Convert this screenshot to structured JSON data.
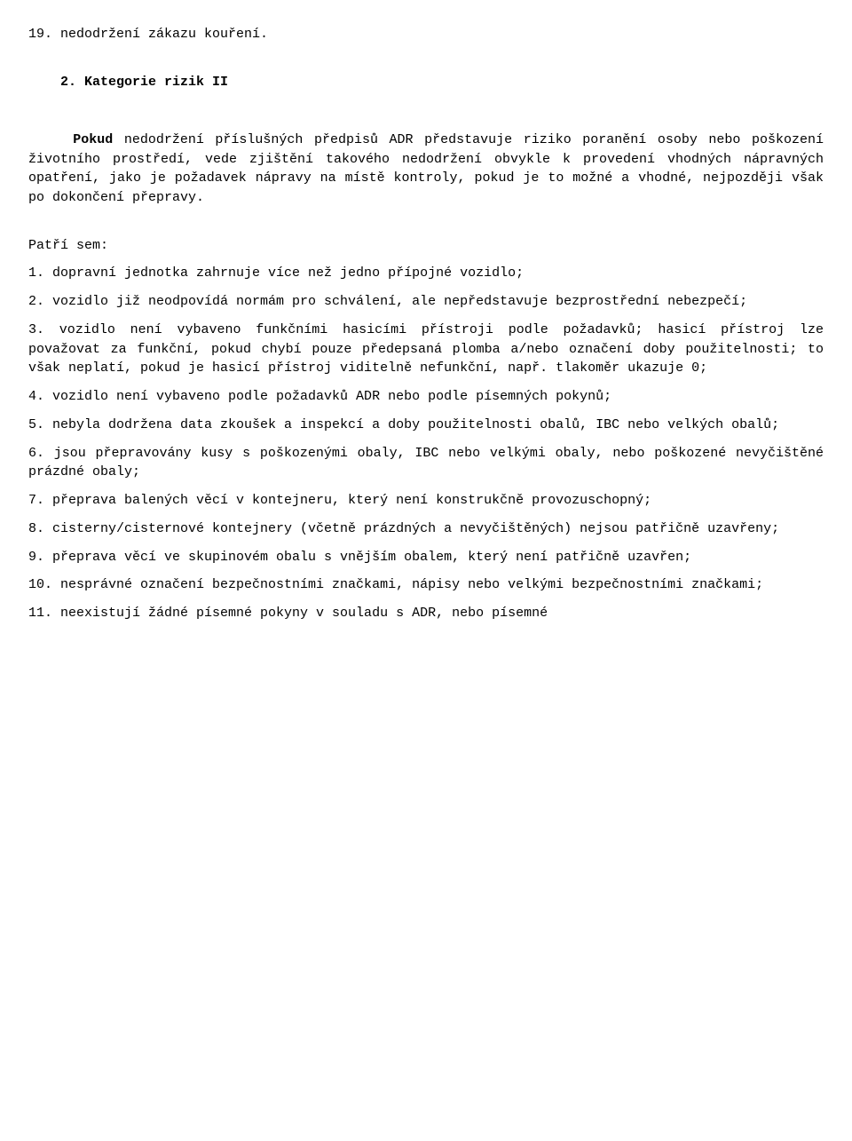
{
  "content": {
    "line_heading_19": "19. nedodržení zákazu kouření.",
    "heading_2": "2. Kategorie rizik II",
    "para_pokud": "Pokud nedodržení příslušných předpisů ADR představuje riziko poranění osoby nebo poškození životního prostředí, vede zjištění takového nedodržení obvykle k provedení vhodných nápravných opatření, jako je požadavek nápravy na místě kontroly, pokud je to možné a vhodné, nejpozději však po dokončení přepravy.",
    "patri_sem": "Patří sem:",
    "item_1": "1. dopravní jednotka zahrnuje více než jedno přípojné vozidlo;",
    "item_2": "2.  vozidlo již neodpovídá normám  pro  schválení,  ale nepředstavuje bezprostřední nebezpečí;",
    "item_3_line1": "3.  vozidlo není vybaveno funkčními hasicími přístroji podle",
    "item_3_line2": "požadavků; hasicí přístroj lze považovat za funkční, pokud chybí pouze předepsaná plomba a/nebo označení doby použitelnosti; to však neplatí, pokud je hasicí přístroj viditelně nefunkční, např. tlakoměr ukazuje 0;",
    "item_4_line1": "4.  vozidlo není vybaveno podle požadavků ADR nebo podle",
    "item_4_line2": "písemných pokynů;",
    "item_5_line1": "5. nebyla dodržena data zkoušek a inspekcí a doby použitelnosti",
    "item_5_line2": "obalů, IBC nebo velkých obalů;",
    "item_6_line1": "6. jsou přepravovány kusy s poškozenými obaly, IBC nebo velkými",
    "item_6_line2": "obaly, nebo poškozené nevyčištěné prázdné obaly;",
    "item_7_line1": "7. přeprava balených věcí v kontejneru, který není konstrukčně",
    "item_7_line2": "provozuschopný;",
    "item_8_line1": "8.  cisterny/cisternové  kontejnery  (včetně  prázdných  a",
    "item_8_line2": "nevyčištěných) nejsou patřičně uzavřeny;",
    "item_9": "9. přeprava věcí ve skupinovém obalu s vnějším obalem, který není patřičně uzavřen;",
    "item_10_line1": "10. nesprávné označení bezpečnostními značkami, nápisy nebo",
    "item_10_line2": "velkými bezpečnostními značkami;",
    "item_11_partial": "11. neexistují žádné písemné pokyny v souladu s ADR, nebo písemné"
  }
}
